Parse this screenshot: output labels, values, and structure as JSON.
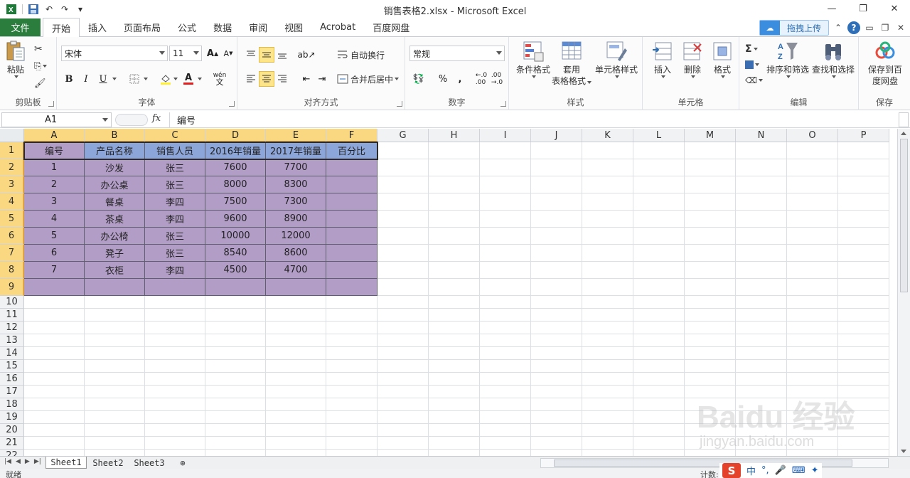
{
  "window": {
    "title": "销售表格2.xlsx  -  Microsoft Excel"
  },
  "ribbon_tabs": {
    "file": "文件",
    "items": [
      "开始",
      "插入",
      "页面布局",
      "公式",
      "数据",
      "审阅",
      "视图",
      "Acrobat",
      "百度网盘"
    ],
    "active_index": 0,
    "upload_label": "拖拽上传"
  },
  "clipboard": {
    "paste": "粘贴",
    "title": "剪贴板"
  },
  "font": {
    "name": "宋体",
    "size": "11",
    "title": "字体",
    "bold": "B",
    "italic": "I",
    "underline": "U",
    "increase": "A",
    "decrease": "A",
    "color_letter": "A",
    "phonetic": "wén"
  },
  "alignment": {
    "wrap": "自动换行",
    "merge": "合并后居中",
    "title": "对齐方式"
  },
  "number": {
    "format": "常规",
    "percent": "%",
    "comma": ",",
    "title": "数字"
  },
  "styles": {
    "conditional": "条件格式",
    "table_line1": "套用",
    "table_line2": "表格格式",
    "cell_styles": "单元格样式",
    "title": "样式"
  },
  "cells": {
    "insert": "插入",
    "delete": "删除",
    "format": "格式",
    "title": "单元格"
  },
  "editing": {
    "sort": "排序和筛选",
    "find": "查找和选择",
    "title": "编辑",
    "sum": "Σ"
  },
  "save": {
    "line1": "保存到百",
    "line2": "度网盘",
    "title": "保存"
  },
  "formula_bar": {
    "name_box": "A1",
    "fx": "fx",
    "content": "编号"
  },
  "columns": [
    "A",
    "B",
    "C",
    "D",
    "E",
    "F",
    "G",
    "H",
    "I",
    "J",
    "K",
    "L",
    "M",
    "N",
    "O",
    "P"
  ],
  "rows": [
    "1",
    "2",
    "3",
    "4",
    "5",
    "6",
    "7",
    "8",
    "9",
    "10",
    "11",
    "12",
    "13",
    "14",
    "15",
    "16",
    "17",
    "18",
    "19",
    "20",
    "21",
    "22"
  ],
  "table": {
    "headers": [
      "编号",
      "产品名称",
      "销售人员",
      "2016年销量",
      "2017年销量",
      "百分比"
    ],
    "rows": [
      [
        "1",
        "沙发",
        "张三",
        "7600",
        "7700",
        ""
      ],
      [
        "2",
        "办公桌",
        "张三",
        "8000",
        "8300",
        ""
      ],
      [
        "3",
        "餐桌",
        "李四",
        "7500",
        "7300",
        ""
      ],
      [
        "4",
        "茶桌",
        "李四",
        "9600",
        "8900",
        ""
      ],
      [
        "5",
        "办公椅",
        "张三",
        "10000",
        "12000",
        ""
      ],
      [
        "6",
        "凳子",
        "张三",
        "8540",
        "8600",
        ""
      ],
      [
        "7",
        "衣柜",
        "李四",
        "4500",
        "4700",
        ""
      ],
      [
        "",
        "",
        "",
        "",
        "",
        ""
      ]
    ]
  },
  "sheets": [
    "Sheet1",
    "Sheet2",
    "Sheet3"
  ],
  "active_sheet": 0,
  "status": {
    "ready": "就绪",
    "count": "计数:"
  },
  "ime": {
    "logo": "S",
    "lang": "中"
  },
  "watermark": {
    "text": "Baidu 经验",
    "sub": "jingyan.baidu.com"
  },
  "colors": {
    "purple_fill": "#b29dc7",
    "header_blue": "#8da6d9",
    "file_tab": "#2a7d3d",
    "selected_header": "#f9d881"
  }
}
